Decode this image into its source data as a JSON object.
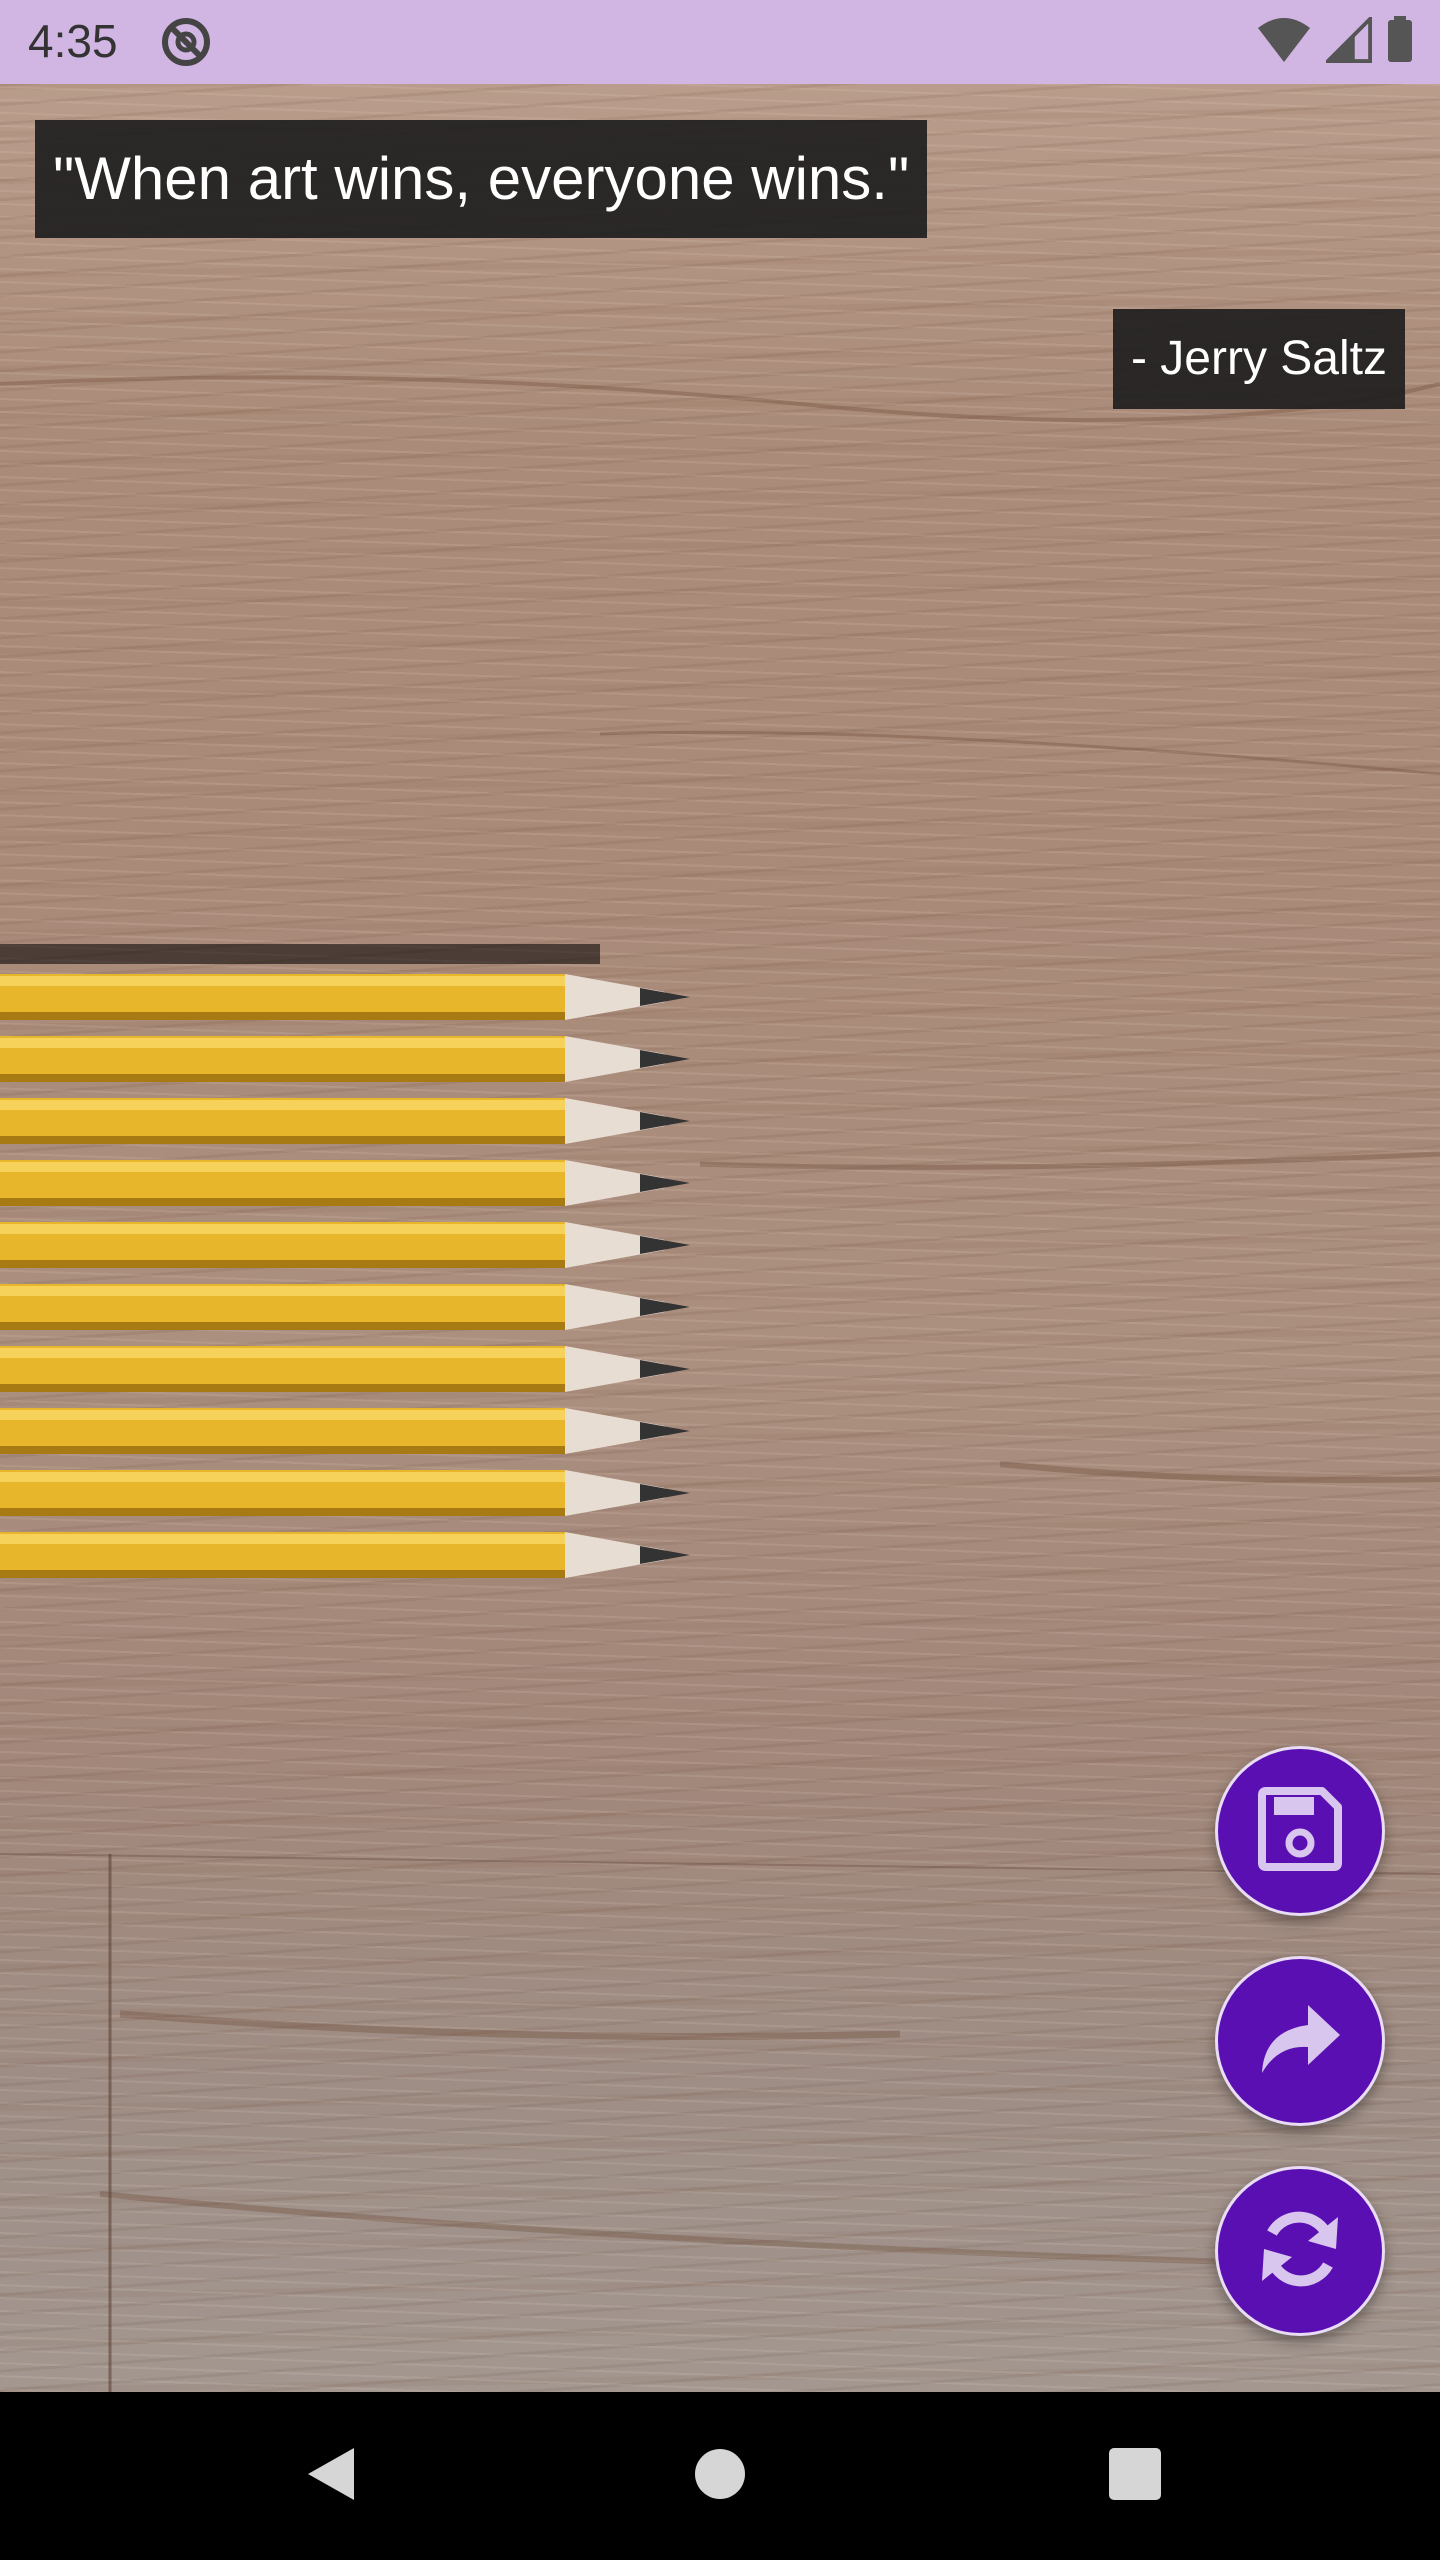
{
  "status_bar": {
    "time": "4:35",
    "icons": [
      "do-not-disturb-icon",
      "wifi-icon",
      "cellular-signal-icon",
      "battery-icon"
    ],
    "background_color": "#d1b5e3"
  },
  "quote": {
    "text": "\"When art wins, everyone wins.\"",
    "author": "- Jerry Saltz"
  },
  "actions": {
    "save_icon": "save-icon",
    "share_icon": "share-icon",
    "refresh_icon": "refresh-icon",
    "fab_color": "#5a0fb3",
    "icon_color": "#d9c6ef"
  },
  "nav_bar": {
    "icons": [
      "back-icon",
      "home-icon",
      "recents-icon"
    ]
  }
}
